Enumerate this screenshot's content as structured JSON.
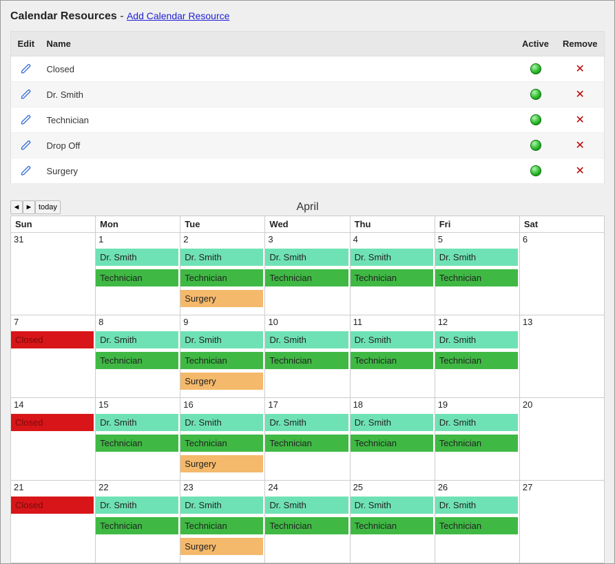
{
  "header": {
    "title": "Calendar Resources",
    "dash": " - ",
    "add_link": "Add Calendar Resource"
  },
  "resources_table": {
    "cols": {
      "edit": "Edit",
      "name": "Name",
      "active": "Active",
      "remove": "Remove"
    },
    "rows": [
      {
        "name": "Closed"
      },
      {
        "name": "Dr. Smith"
      },
      {
        "name": "Technician"
      },
      {
        "name": "Drop Off"
      },
      {
        "name": "Surgery"
      }
    ]
  },
  "calendar": {
    "today_label": "today",
    "month_label": "April",
    "day_headers": [
      "Sun",
      "Mon",
      "Tue",
      "Wed",
      "Thu",
      "Fri",
      "Sat"
    ],
    "event_colors": {
      "Closed": "ev-closed",
      "Dr. Smith": "ev-drsmith",
      "Technician": "ev-tech",
      "Surgery": "ev-surgery"
    },
    "weeks": [
      [
        {
          "num": "31",
          "events": []
        },
        {
          "num": "1",
          "events": [
            "Dr. Smith",
            "Technician"
          ]
        },
        {
          "num": "2",
          "events": [
            "Dr. Smith",
            "Technician",
            "Surgery"
          ]
        },
        {
          "num": "3",
          "events": [
            "Dr. Smith",
            "Technician"
          ]
        },
        {
          "num": "4",
          "events": [
            "Dr. Smith",
            "Technician"
          ]
        },
        {
          "num": "5",
          "events": [
            "Dr. Smith",
            "Technician"
          ]
        },
        {
          "num": "6",
          "events": []
        }
      ],
      [
        {
          "num": "7",
          "events": [
            "Closed"
          ]
        },
        {
          "num": "8",
          "events": [
            "Dr. Smith",
            "Technician"
          ]
        },
        {
          "num": "9",
          "events": [
            "Dr. Smith",
            "Technician",
            "Surgery"
          ]
        },
        {
          "num": "10",
          "events": [
            "Dr. Smith",
            "Technician"
          ]
        },
        {
          "num": "11",
          "events": [
            "Dr. Smith",
            "Technician"
          ]
        },
        {
          "num": "12",
          "events": [
            "Dr. Smith",
            "Technician"
          ]
        },
        {
          "num": "13",
          "events": []
        }
      ],
      [
        {
          "num": "14",
          "events": [
            "Closed"
          ]
        },
        {
          "num": "15",
          "events": [
            "Dr. Smith",
            "Technician"
          ]
        },
        {
          "num": "16",
          "events": [
            "Dr. Smith",
            "Technician",
            "Surgery"
          ]
        },
        {
          "num": "17",
          "events": [
            "Dr. Smith",
            "Technician"
          ]
        },
        {
          "num": "18",
          "events": [
            "Dr. Smith",
            "Technician"
          ]
        },
        {
          "num": "19",
          "events": [
            "Dr. Smith",
            "Technician"
          ]
        },
        {
          "num": "20",
          "events": []
        }
      ],
      [
        {
          "num": "21",
          "events": [
            "Closed"
          ]
        },
        {
          "num": "22",
          "events": [
            "Dr. Smith",
            "Technician"
          ]
        },
        {
          "num": "23",
          "events": [
            "Dr. Smith",
            "Technician",
            "Surgery"
          ]
        },
        {
          "num": "24",
          "events": [
            "Dr. Smith",
            "Technician"
          ]
        },
        {
          "num": "25",
          "events": [
            "Dr. Smith",
            "Technician"
          ]
        },
        {
          "num": "26",
          "events": [
            "Dr. Smith",
            "Technician"
          ]
        },
        {
          "num": "27",
          "events": []
        }
      ]
    ]
  }
}
